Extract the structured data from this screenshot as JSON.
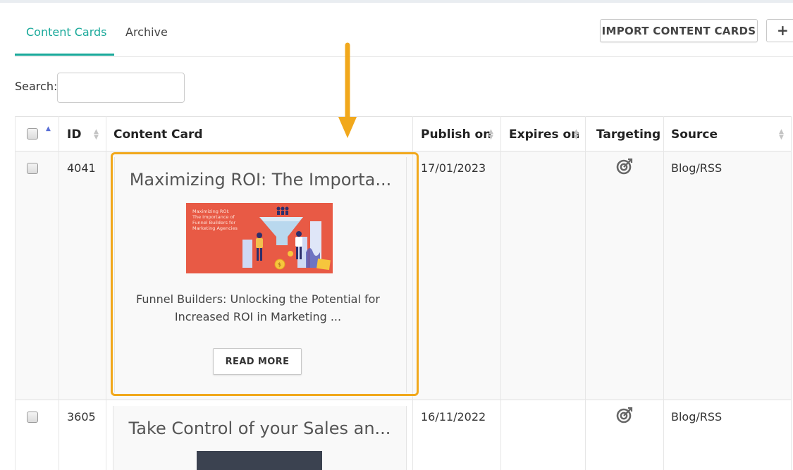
{
  "tabs": [
    {
      "label": "Content Cards",
      "active": true
    },
    {
      "label": "Archive",
      "active": false
    }
  ],
  "toolbar": {
    "import_label": "IMPORT CONTENT CARDS",
    "add_label": "+"
  },
  "search": {
    "label": "Search:",
    "value": "",
    "placeholder": ""
  },
  "table": {
    "headers": [
      "ID",
      "Content Card",
      "Publish on",
      "Expires on",
      "Targeting",
      "Source"
    ],
    "rows": [
      {
        "id": "4041",
        "card": {
          "title": "Maximizing ROI: The Importa...",
          "image_text": [
            "Maximizing ROI:",
            "The Importance of",
            "Funnel Builders for",
            "Marketing Agencies"
          ],
          "description": "Funnel Builders: Unlocking the Potential for Increased ROI in Marketing ...",
          "button": "READ MORE"
        },
        "publish_on": "17/01/2023",
        "expires_on": "",
        "targeting_icon": "target-icon",
        "source": "Blog/RSS"
      },
      {
        "id": "3605",
        "card": {
          "title": "Take Control of your Sales an..."
        },
        "publish_on": "16/11/2022",
        "expires_on": "",
        "targeting_icon": "target-icon",
        "source": "Blog/RSS"
      }
    ]
  },
  "colors": {
    "accent": "#1aa99a",
    "highlight": "#f1a81c",
    "sort_active": "#5a6fd6",
    "thumb_bg": "#e85a45"
  }
}
